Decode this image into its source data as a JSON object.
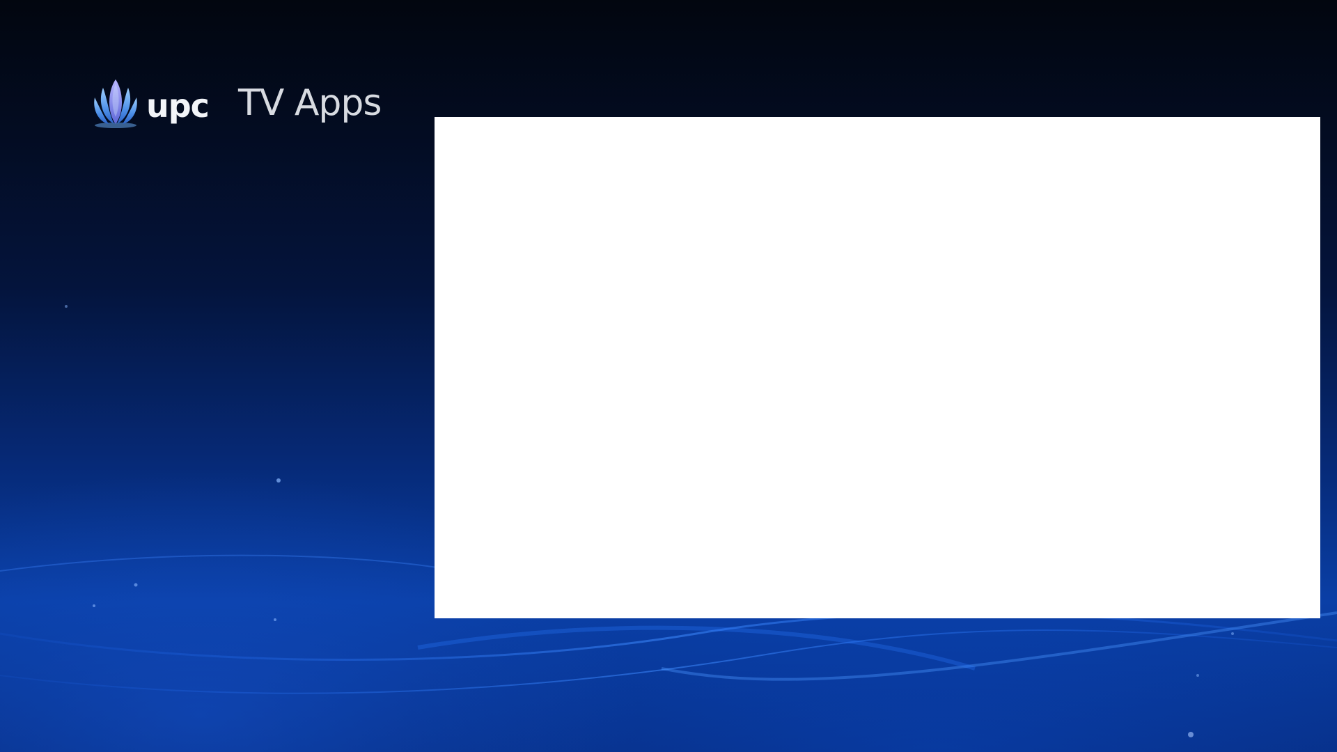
{
  "header": {
    "brand_name": "upc",
    "title": "TV Apps"
  },
  "logo": {
    "icon": "upc-flame-logo-icon"
  },
  "colors": {
    "background_dark": "#02060f",
    "background_blue": "#0a3fa6",
    "panel": "#ffffff",
    "title_text": "#d8dbe1"
  }
}
